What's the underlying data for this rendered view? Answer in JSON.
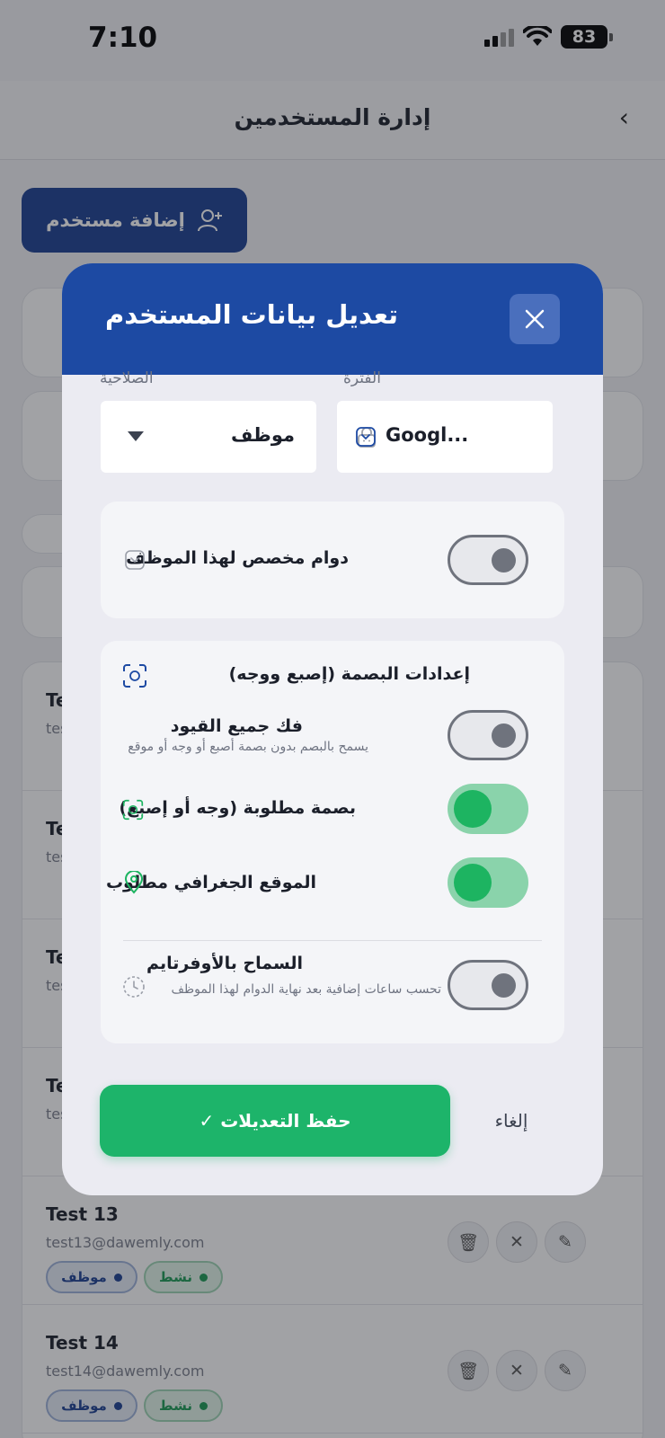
{
  "status_bar": {
    "time": "7:10",
    "battery": "83"
  },
  "header": {
    "title": "إدارة المستخدمين",
    "back": "‹"
  },
  "add_user_button": "إضافة مستخدم",
  "users": [
    {
      "name": "Test 13",
      "email": "test13@dawemly.com",
      "role": "موظف",
      "status": "نشط"
    },
    {
      "name": "Test 14",
      "email": "test14@dawemly.com",
      "role": "موظف",
      "status": "نشط"
    }
  ],
  "partial_rows": [
    {
      "name": "Te",
      "email": "tes"
    },
    {
      "name": "Te",
      "email": "tes"
    },
    {
      "name": "Te",
      "email": "tes"
    },
    {
      "name": "Te",
      "email": "tes"
    }
  ],
  "modal": {
    "title": "تعديل بيانات المستخدم",
    "role_label": "الصلاحية",
    "role_value": "موظف",
    "period_label": "الفترة",
    "period_value": "Googl...",
    "custom_shift": {
      "label": "دوام مخصص لهذا الموظف",
      "enabled": false
    },
    "biometric": {
      "title": "إعدادات البصمة (إصبع ووجه)",
      "unlock_all": {
        "label": "فك جميع القيود",
        "description": "يسمح بالبصم بدون بصمة أصبع أو وجه أو موقع",
        "enabled": false
      },
      "fingerprint_required": {
        "label": "بصمة مطلوبة (وجه أو إصبع)",
        "enabled": true
      },
      "location_required": {
        "label": "الموقع الجغرافي مطلوب",
        "enabled": true
      },
      "overtime": {
        "label": "السماح بالأوفرتايم",
        "description": "تحسب ساعات إضافية بعد نهاية الدوام لهذا الموظف",
        "enabled": false
      }
    },
    "save_button": "✓ حفظ التعديلات",
    "cancel_button": "إلغاء"
  },
  "colors": {
    "primary": "#1d4aa3",
    "success": "#1db46a",
    "toggle_on": "#8ad3ab"
  }
}
